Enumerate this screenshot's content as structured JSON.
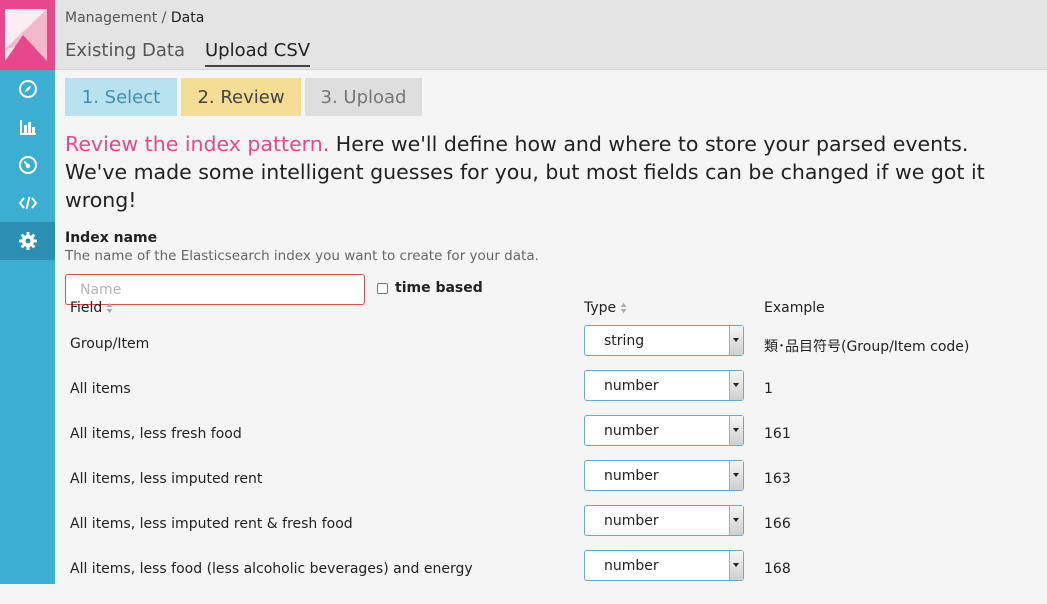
{
  "breadcrumb": {
    "parent": "Management",
    "separator": " / ",
    "current": "Data"
  },
  "tabs": [
    {
      "label": "Existing Data",
      "active": false
    },
    {
      "label": "Upload CSV",
      "active": true
    }
  ],
  "sidebar": {
    "items": [
      {
        "icon": "compass-icon"
      },
      {
        "icon": "bar-chart-icon"
      },
      {
        "icon": "dashboard-icon"
      },
      {
        "icon": "code-icon"
      },
      {
        "icon": "gear-icon",
        "active": true
      }
    ]
  },
  "steps": [
    {
      "label": "1. Select"
    },
    {
      "label": "2. Review"
    },
    {
      "label": "3. Upload"
    }
  ],
  "intro": {
    "lead": "Review the index pattern.",
    "text": " Here we'll define how and where to store your parsed events. We've made some intelligent guesses for you, but most fields can be changed if we got it wrong!"
  },
  "index": {
    "label": "Index name",
    "help": "The name of the Elasticsearch index you want to create for your data.",
    "placeholder": "Name",
    "value": "",
    "time_based_label": "time based"
  },
  "table": {
    "headers": {
      "field": "Field",
      "type": "Type",
      "example": "Example"
    },
    "rows": [
      {
        "field": "Group/Item",
        "type": "string",
        "example": "類･品目符号(Group/Item code)"
      },
      {
        "field": "All items",
        "type": "number",
        "example": "1"
      },
      {
        "field": "All items, less fresh food",
        "type": "number",
        "example": "161"
      },
      {
        "field": "All items, less imputed rent",
        "type": "number",
        "example": "163"
      },
      {
        "field": "All items, less imputed rent & fresh food",
        "type": "number",
        "example": "166"
      },
      {
        "field": "All items, less food (less alcoholic beverages) and energy",
        "type": "number",
        "example": "168"
      }
    ]
  },
  "colors": {
    "accent": "#e8488b",
    "sidebar": "#3caed2",
    "header": "#e4e4e4",
    "invalid_border": "#d9534f"
  }
}
